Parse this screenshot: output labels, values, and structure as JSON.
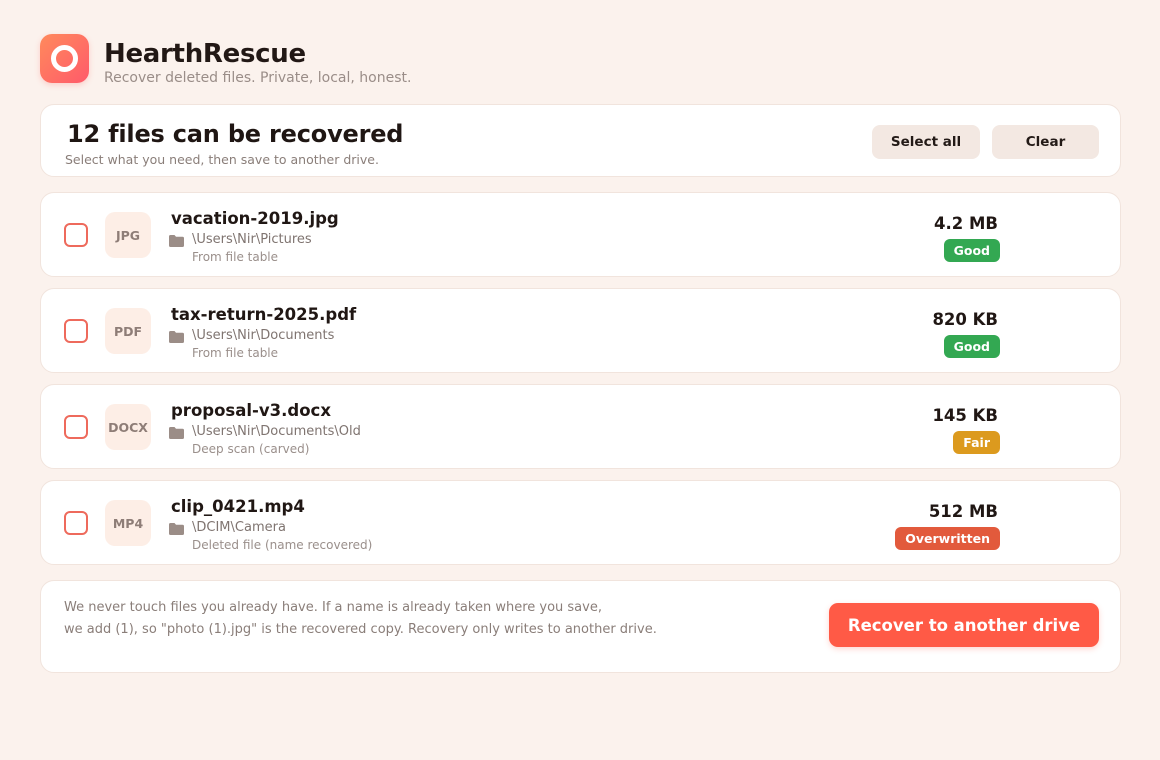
{
  "app": {
    "name": "HearthRescue",
    "tagline": "Recover deleted files. Private, local, honest."
  },
  "summary": {
    "title": "12 files can be recovered",
    "subtitle": "Select what you need, then save to another drive.",
    "select_all_label": "Select all",
    "clear_label": "Clear"
  },
  "files": [
    {
      "type": "JPG",
      "name": "vacation-2019.jpg",
      "path": "\\Users\\Nir\\Pictures",
      "source": "From file table",
      "size": "4.2 MB",
      "status": "Good",
      "status_color": "#33a852",
      "checked": false,
      "icon": "folder-icon"
    },
    {
      "type": "PDF",
      "name": "tax-return-2025.pdf",
      "path": "\\Users\\Nir\\Documents",
      "source": "From file table",
      "size": "820 KB",
      "status": "Good",
      "status_color": "#33a852",
      "checked": false,
      "icon": "folder-icon"
    },
    {
      "type": "DOCX",
      "name": "proposal-v3.docx",
      "path": "\\Users\\Nir\\Documents\\Old",
      "source": "Deep scan (carved)",
      "size": "145 KB",
      "status": "Fair",
      "status_color": "#dc9a1e",
      "checked": false,
      "icon": "folder-icon"
    },
    {
      "type": "MP4",
      "name": "clip_0421.mp4",
      "path": "\\DCIM\\Camera",
      "source": "Deleted file (name recovered)",
      "size": "512 MB",
      "status": "Overwritten",
      "status_color": "#e25a3c",
      "checked": false,
      "icon": "folder-icon"
    }
  ],
  "footer": {
    "line1": "We never touch files you already have. If a name is already taken where you save,",
    "line2": "we add (1), so \"photo (1).jpg\" is the recovered copy. Recovery only writes to another drive.",
    "recover_label": "Recover to another drive"
  },
  "colors": {
    "background": "#fbf2ed",
    "accent": "#ff5a46",
    "checkbox_border": "#ee6a5c"
  }
}
